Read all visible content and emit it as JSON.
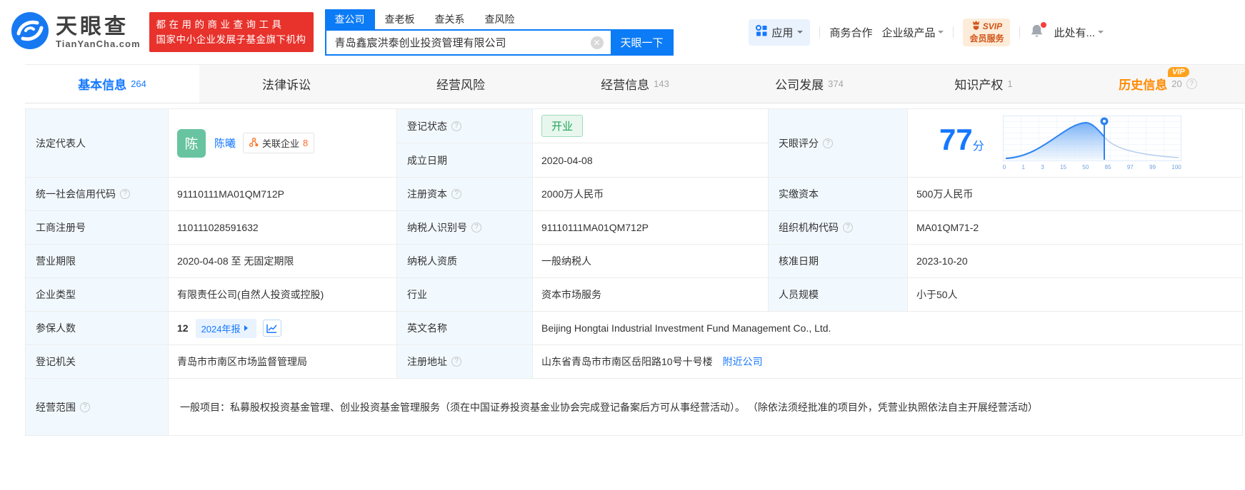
{
  "header": {
    "logo": {
      "title": "天眼查",
      "subtitle": "TianYanCha.com"
    },
    "banner": {
      "line1": "都在用的商业查询工具",
      "line2": "国家中小企业发展子基金旗下机构"
    },
    "search": {
      "tab_company": "查公司",
      "tab_boss": "查老板",
      "tab_relation": "查关系",
      "tab_risk": "查风险",
      "value": "青岛鑫宸洪泰创业投资管理有限公司",
      "clear": "✕",
      "button": "天眼一下"
    },
    "nav": {
      "apps": "应用",
      "biz": "商务合作",
      "enterprise": "企业级产品",
      "svip_line1": "SVIP",
      "svip_line2": "会员服务",
      "user": "此处有..."
    }
  },
  "tabs": [
    {
      "label": "基本信息",
      "count": "264"
    },
    {
      "label": "法律诉讼",
      "count": ""
    },
    {
      "label": "经营风险",
      "count": ""
    },
    {
      "label": "经营信息",
      "count": "143"
    },
    {
      "label": "公司发展",
      "count": "374"
    },
    {
      "label": "知识产权",
      "count": "1"
    },
    {
      "label": "历史信息",
      "count": "20",
      "vip": "VIP"
    }
  ],
  "profile": {
    "legal_rep": {
      "label": "法定代表人",
      "avatar": "陈",
      "name": "陈曦",
      "related_label": "关联企业",
      "related_count": "8"
    },
    "reg_status": {
      "label": "登记状态",
      "value": "开业"
    },
    "est_date": {
      "label": "成立日期",
      "value": "2020-04-08"
    },
    "score": {
      "label": "天眼评分",
      "value": "77",
      "unit": "分",
      "axis": [
        "0",
        "1",
        "3",
        "15",
        "50",
        "85",
        "97",
        "99",
        "100"
      ]
    },
    "rows": [
      [
        {
          "label": "统一社会信用代码",
          "value": "91110111MA01QM712P"
        },
        {
          "label": "注册资本",
          "value": "2000万人民币"
        },
        {
          "label": "实缴资本",
          "value": "500万人民币"
        }
      ],
      [
        {
          "label": "工商注册号",
          "value": "110111028591632"
        },
        {
          "label": "纳税人识别号",
          "value": "91110111MA01QM712P"
        },
        {
          "label": "组织机构代码",
          "value": "MA01QM71-2"
        }
      ],
      [
        {
          "label": "营业期限",
          "value": "2020-04-08 至 无固定期限"
        },
        {
          "label": "纳税人资质",
          "value": "一般纳税人"
        },
        {
          "label": "核准日期",
          "value": "2023-10-20"
        }
      ],
      [
        {
          "label": "企业类型",
          "value": "有限责任公司(自然人投资或控股)"
        },
        {
          "label": "行业",
          "value": "资本市场服务"
        },
        {
          "label": "人员规模",
          "value": "小于50人"
        }
      ]
    ],
    "insured": {
      "label": "参保人数",
      "value": "12",
      "badge": "2024年报"
    },
    "english_name": {
      "label": "英文名称",
      "value": "Beijing Hongtai Industrial Investment Fund Management Co., Ltd."
    },
    "reg_authority": {
      "label": "登记机关",
      "value": "青岛市市南区市场监督管理局"
    },
    "reg_address": {
      "label": "注册地址",
      "value": "山东省青岛市市南区岳阳路10号十号楼",
      "link": "附近公司"
    },
    "business_scope": {
      "label": "经营范围",
      "value": "一般项目：私募股权投资基金管理、创业投资基金管理服务（须在中国证券投资基金业协会完成登记备案后方可从事经营活动）。 （除依法须经批准的项目外，凭营业执照依法自主开展经营活动）"
    }
  }
}
